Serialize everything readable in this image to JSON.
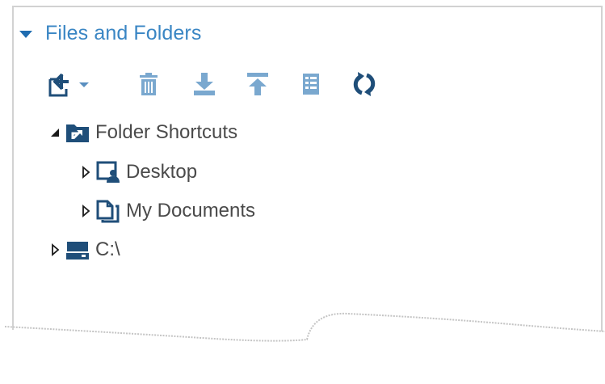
{
  "panel": {
    "title": "Files and Folders",
    "accent_color": "#3a86c4",
    "icon_color": "#1f4e79",
    "disabled_icon_color": "#7aa8cf"
  },
  "toolbar": {
    "buttons": [
      {
        "name": "new-item-menu-button",
        "icon": "new-item-icon",
        "enabled": true
      },
      {
        "name": "delete-button",
        "icon": "trash-icon",
        "enabled": false
      },
      {
        "name": "download-button",
        "icon": "download-icon",
        "enabled": false
      },
      {
        "name": "upload-button",
        "icon": "upload-icon",
        "enabled": false
      },
      {
        "name": "properties-button",
        "icon": "properties-icon",
        "enabled": false
      },
      {
        "name": "refresh-button",
        "icon": "refresh-icon",
        "enabled": true
      }
    ]
  },
  "tree": {
    "folder_shortcuts": {
      "label": "Folder Shortcuts",
      "expanded": true,
      "icon": "folder-shortcut-icon"
    },
    "desktop": {
      "label": "Desktop",
      "expanded": false,
      "icon": "desktop-icon"
    },
    "my_documents": {
      "label": "My Documents",
      "expanded": false,
      "icon": "documents-icon"
    },
    "c_drive": {
      "label": "C:\\",
      "expanded": false,
      "icon": "drive-icon"
    }
  }
}
